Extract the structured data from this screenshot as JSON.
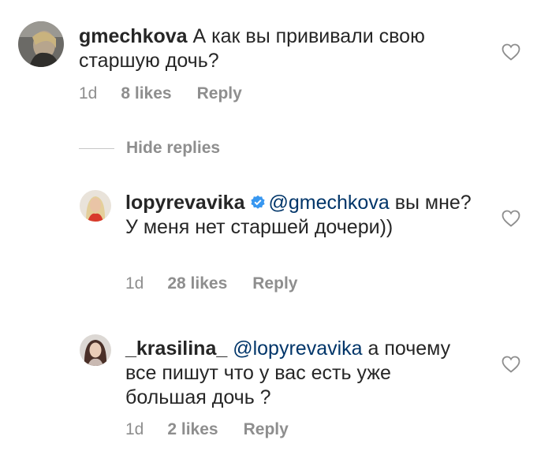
{
  "comments": [
    {
      "username": "gmechkova",
      "mention": "",
      "text": "А как вы прививали свою старшую дочь?",
      "time": "1d",
      "likes": "8 likes",
      "reply": "Reply"
    },
    {
      "username": "lopyrevavika",
      "mention": "@gmechkova",
      "text": "вы мне? У меня нет старшей дочери))",
      "time": "1d",
      "likes": "28 likes",
      "reply": "Reply"
    },
    {
      "username": "_krasilina_",
      "mention": "@lopyrevavika",
      "text": "а почему все пишут что у вас есть уже большая дочь ?",
      "time": "1d",
      "likes": "2 likes",
      "reply": "Reply"
    }
  ],
  "hide_replies_label": "Hide replies",
  "colors": {
    "text": "#262626",
    "meta": "#8e8e8e",
    "mention": "#003569",
    "verified": "#3897f0"
  },
  "icons": {
    "like": "heart-outline-icon",
    "verified": "verified-badge-icon"
  }
}
